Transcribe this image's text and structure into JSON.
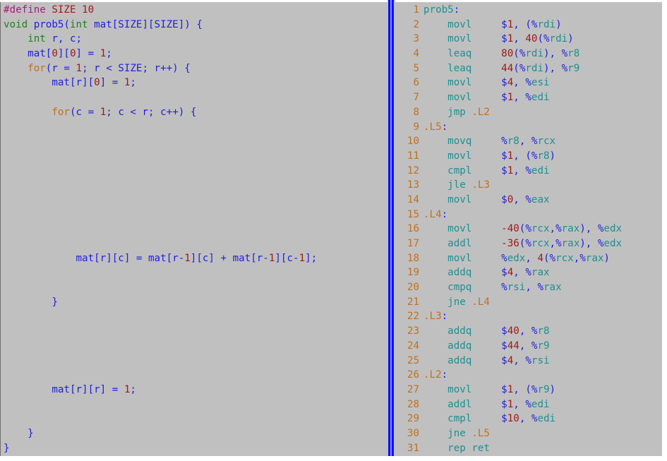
{
  "c_source": {
    "lines": [
      [
        {
          "t": "#define ",
          "c": "pp"
        },
        {
          "t": "SIZE 10",
          "c": "num"
        }
      ],
      [
        {
          "t": "void",
          "c": "ty"
        },
        {
          "t": " prob5(",
          "c": "id"
        },
        {
          "t": "int",
          "c": "ty"
        },
        {
          "t": " mat[SIZE][SIZE]) {",
          "c": "id"
        }
      ],
      [
        {
          "t": "    int",
          "c": "ty"
        },
        {
          "t": " r, c;",
          "c": "id"
        }
      ],
      [
        {
          "t": "    mat[",
          "c": "id"
        },
        {
          "t": "0",
          "c": "num"
        },
        {
          "t": "][",
          "c": "id"
        },
        {
          "t": "0",
          "c": "num"
        },
        {
          "t": "] = ",
          "c": "id"
        },
        {
          "t": "1",
          "c": "num"
        },
        {
          "t": ";",
          "c": "id"
        }
      ],
      [
        {
          "t": "    for",
          "c": "kw"
        },
        {
          "t": "(r = ",
          "c": "id"
        },
        {
          "t": "1",
          "c": "num"
        },
        {
          "t": "; r < SIZE; r++) {",
          "c": "id"
        }
      ],
      [
        {
          "t": "        mat[r][",
          "c": "id"
        },
        {
          "t": "0",
          "c": "num"
        },
        {
          "t": "] = ",
          "c": "id"
        },
        {
          "t": "1",
          "c": "num"
        },
        {
          "t": ";",
          "c": "id"
        }
      ],
      [],
      [
        {
          "t": "        for",
          "c": "kw"
        },
        {
          "t": "(c = ",
          "c": "id"
        },
        {
          "t": "1",
          "c": "num"
        },
        {
          "t": "; c < r; c++) {",
          "c": "id"
        }
      ],
      [],
      [],
      [],
      [],
      [],
      [],
      [],
      [],
      [],
      [
        {
          "t": "            mat[r][c] = mat[r-",
          "c": "id"
        },
        {
          "t": "1",
          "c": "num"
        },
        {
          "t": "][c] + mat[r-",
          "c": "id"
        },
        {
          "t": "1",
          "c": "num"
        },
        {
          "t": "][c-",
          "c": "id"
        },
        {
          "t": "1",
          "c": "num"
        },
        {
          "t": "];",
          "c": "id"
        }
      ],
      [],
      [],
      [
        {
          "t": "        }",
          "c": "id"
        }
      ],
      [],
      [],
      [],
      [],
      [],
      [
        {
          "t": "        mat[r][r] = ",
          "c": "id"
        },
        {
          "t": "1",
          "c": "num"
        },
        {
          "t": ";",
          "c": "id"
        }
      ],
      [],
      [],
      [
        {
          "t": "    }",
          "c": "id"
        }
      ],
      [
        {
          "t": "}",
          "c": "id"
        }
      ]
    ]
  },
  "asm_source": {
    "lines": [
      {
        "n": "1",
        "label": "prob5",
        "parts": []
      },
      {
        "n": "2",
        "op": "movl",
        "parts": [
          {
            "t": "$",
            "c": "sym"
          },
          {
            "t": "1",
            "c": "num"
          },
          {
            "t": ", (",
            "c": "sym"
          },
          {
            "t": "%",
            "c": "sym"
          },
          {
            "t": "rdi",
            "c": "reg"
          },
          {
            "t": ")",
            "c": "sym"
          }
        ]
      },
      {
        "n": "3",
        "op": "movl",
        "parts": [
          {
            "t": "$",
            "c": "sym"
          },
          {
            "t": "1",
            "c": "num"
          },
          {
            "t": ", ",
            "c": "sym"
          },
          {
            "t": "40",
            "c": "num"
          },
          {
            "t": "(",
            "c": "sym"
          },
          {
            "t": "%",
            "c": "sym"
          },
          {
            "t": "rdi",
            "c": "reg"
          },
          {
            "t": ")",
            "c": "sym"
          }
        ]
      },
      {
        "n": "4",
        "op": "leaq",
        "parts": [
          {
            "t": "80",
            "c": "num"
          },
          {
            "t": "(",
            "c": "sym"
          },
          {
            "t": "%",
            "c": "sym"
          },
          {
            "t": "rdi",
            "c": "reg"
          },
          {
            "t": "), ",
            "c": "sym"
          },
          {
            "t": "%",
            "c": "sym"
          },
          {
            "t": "r8",
            "c": "reg"
          }
        ]
      },
      {
        "n": "5",
        "op": "leaq",
        "parts": [
          {
            "t": "44",
            "c": "num"
          },
          {
            "t": "(",
            "c": "sym"
          },
          {
            "t": "%",
            "c": "sym"
          },
          {
            "t": "rdi",
            "c": "reg"
          },
          {
            "t": "), ",
            "c": "sym"
          },
          {
            "t": "%",
            "c": "sym"
          },
          {
            "t": "r9",
            "c": "reg"
          }
        ]
      },
      {
        "n": "6",
        "op": "movl",
        "parts": [
          {
            "t": "$",
            "c": "sym"
          },
          {
            "t": "4",
            "c": "num"
          },
          {
            "t": ", ",
            "c": "sym"
          },
          {
            "t": "%",
            "c": "sym"
          },
          {
            "t": "esi",
            "c": "reg"
          }
        ]
      },
      {
        "n": "7",
        "op": "movl",
        "parts": [
          {
            "t": "$",
            "c": "sym"
          },
          {
            "t": "1",
            "c": "num"
          },
          {
            "t": ", ",
            "c": "sym"
          },
          {
            "t": "%",
            "c": "sym"
          },
          {
            "t": "edi",
            "c": "reg"
          }
        ]
      },
      {
        "n": "8",
        "op": "jmp",
        "target": ".L2",
        "parts": []
      },
      {
        "n": "9",
        "label": ".L5",
        "parts": []
      },
      {
        "n": "10",
        "op": "movq",
        "parts": [
          {
            "t": "%",
            "c": "sym"
          },
          {
            "t": "r8",
            "c": "reg"
          },
          {
            "t": ", ",
            "c": "sym"
          },
          {
            "t": "%",
            "c": "sym"
          },
          {
            "t": "rcx",
            "c": "reg"
          }
        ]
      },
      {
        "n": "11",
        "op": "movl",
        "parts": [
          {
            "t": "$",
            "c": "sym"
          },
          {
            "t": "1",
            "c": "num"
          },
          {
            "t": ", (",
            "c": "sym"
          },
          {
            "t": "%",
            "c": "sym"
          },
          {
            "t": "r8",
            "c": "reg"
          },
          {
            "t": ")",
            "c": "sym"
          }
        ]
      },
      {
        "n": "12",
        "op": "cmpl",
        "parts": [
          {
            "t": "$",
            "c": "sym"
          },
          {
            "t": "1",
            "c": "num"
          },
          {
            "t": ", ",
            "c": "sym"
          },
          {
            "t": "%",
            "c": "sym"
          },
          {
            "t": "edi",
            "c": "reg"
          }
        ]
      },
      {
        "n": "13",
        "op": "jle",
        "target": ".L3",
        "parts": []
      },
      {
        "n": "14",
        "op": "movl",
        "parts": [
          {
            "t": "$",
            "c": "sym"
          },
          {
            "t": "0",
            "c": "num"
          },
          {
            "t": ", ",
            "c": "sym"
          },
          {
            "t": "%",
            "c": "sym"
          },
          {
            "t": "eax",
            "c": "reg"
          }
        ]
      },
      {
        "n": "15",
        "label": ".L4",
        "parts": []
      },
      {
        "n": "16",
        "op": "movl",
        "parts": [
          {
            "t": "-40",
            "c": "num"
          },
          {
            "t": "(",
            "c": "sym"
          },
          {
            "t": "%",
            "c": "sym"
          },
          {
            "t": "rcx",
            "c": "reg"
          },
          {
            "t": ",",
            "c": "sym"
          },
          {
            "t": "%",
            "c": "sym"
          },
          {
            "t": "rax",
            "c": "reg"
          },
          {
            "t": "), ",
            "c": "sym"
          },
          {
            "t": "%",
            "c": "sym"
          },
          {
            "t": "edx",
            "c": "reg"
          }
        ]
      },
      {
        "n": "17",
        "op": "addl",
        "parts": [
          {
            "t": "-36",
            "c": "num"
          },
          {
            "t": "(",
            "c": "sym"
          },
          {
            "t": "%",
            "c": "sym"
          },
          {
            "t": "rcx",
            "c": "reg"
          },
          {
            "t": ",",
            "c": "sym"
          },
          {
            "t": "%",
            "c": "sym"
          },
          {
            "t": "rax",
            "c": "reg"
          },
          {
            "t": "), ",
            "c": "sym"
          },
          {
            "t": "%",
            "c": "sym"
          },
          {
            "t": "edx",
            "c": "reg"
          }
        ]
      },
      {
        "n": "18",
        "op": "movl",
        "parts": [
          {
            "t": "%",
            "c": "sym"
          },
          {
            "t": "edx",
            "c": "reg"
          },
          {
            "t": ", ",
            "c": "sym"
          },
          {
            "t": "4",
            "c": "num"
          },
          {
            "t": "(",
            "c": "sym"
          },
          {
            "t": "%",
            "c": "sym"
          },
          {
            "t": "rcx",
            "c": "reg"
          },
          {
            "t": ",",
            "c": "sym"
          },
          {
            "t": "%",
            "c": "sym"
          },
          {
            "t": "rax",
            "c": "reg"
          },
          {
            "t": ")",
            "c": "sym"
          }
        ]
      },
      {
        "n": "19",
        "op": "addq",
        "parts": [
          {
            "t": "$",
            "c": "sym"
          },
          {
            "t": "4",
            "c": "num"
          },
          {
            "t": ", ",
            "c": "sym"
          },
          {
            "t": "%",
            "c": "sym"
          },
          {
            "t": "rax",
            "c": "reg"
          }
        ]
      },
      {
        "n": "20",
        "op": "cmpq",
        "parts": [
          {
            "t": "%",
            "c": "sym"
          },
          {
            "t": "rsi",
            "c": "reg"
          },
          {
            "t": ", ",
            "c": "sym"
          },
          {
            "t": "%",
            "c": "sym"
          },
          {
            "t": "rax",
            "c": "reg"
          }
        ]
      },
      {
        "n": "21",
        "op": "jne",
        "target": ".L4",
        "parts": []
      },
      {
        "n": "22",
        "label": ".L3",
        "parts": []
      },
      {
        "n": "23",
        "op": "addq",
        "parts": [
          {
            "t": "$",
            "c": "sym"
          },
          {
            "t": "40",
            "c": "num"
          },
          {
            "t": ", ",
            "c": "sym"
          },
          {
            "t": "%",
            "c": "sym"
          },
          {
            "t": "r8",
            "c": "reg"
          }
        ]
      },
      {
        "n": "24",
        "op": "addq",
        "parts": [
          {
            "t": "$",
            "c": "sym"
          },
          {
            "t": "44",
            "c": "num"
          },
          {
            "t": ", ",
            "c": "sym"
          },
          {
            "t": "%",
            "c": "sym"
          },
          {
            "t": "r9",
            "c": "reg"
          }
        ]
      },
      {
        "n": "25",
        "op": "addq",
        "parts": [
          {
            "t": "$",
            "c": "sym"
          },
          {
            "t": "4",
            "c": "num"
          },
          {
            "t": ", ",
            "c": "sym"
          },
          {
            "t": "%",
            "c": "sym"
          },
          {
            "t": "rsi",
            "c": "reg"
          }
        ]
      },
      {
        "n": "26",
        "label": ".L2",
        "parts": []
      },
      {
        "n": "27",
        "op": "movl",
        "parts": [
          {
            "t": "$",
            "c": "sym"
          },
          {
            "t": "1",
            "c": "num"
          },
          {
            "t": ", (",
            "c": "sym"
          },
          {
            "t": "%",
            "c": "sym"
          },
          {
            "t": "r9",
            "c": "reg"
          },
          {
            "t": ")",
            "c": "sym"
          }
        ]
      },
      {
        "n": "28",
        "op": "addl",
        "parts": [
          {
            "t": "$",
            "c": "sym"
          },
          {
            "t": "1",
            "c": "num"
          },
          {
            "t": ", ",
            "c": "sym"
          },
          {
            "t": "%",
            "c": "sym"
          },
          {
            "t": "edi",
            "c": "reg"
          }
        ]
      },
      {
        "n": "29",
        "op": "cmpl",
        "parts": [
          {
            "t": "$",
            "c": "sym"
          },
          {
            "t": "10",
            "c": "num"
          },
          {
            "t": ", ",
            "c": "sym"
          },
          {
            "t": "%",
            "c": "sym"
          },
          {
            "t": "edi",
            "c": "reg"
          }
        ]
      },
      {
        "n": "30",
        "op": "jne",
        "target": ".L5",
        "parts": []
      },
      {
        "n": "31",
        "op": "rep ret",
        "parts": []
      }
    ]
  }
}
